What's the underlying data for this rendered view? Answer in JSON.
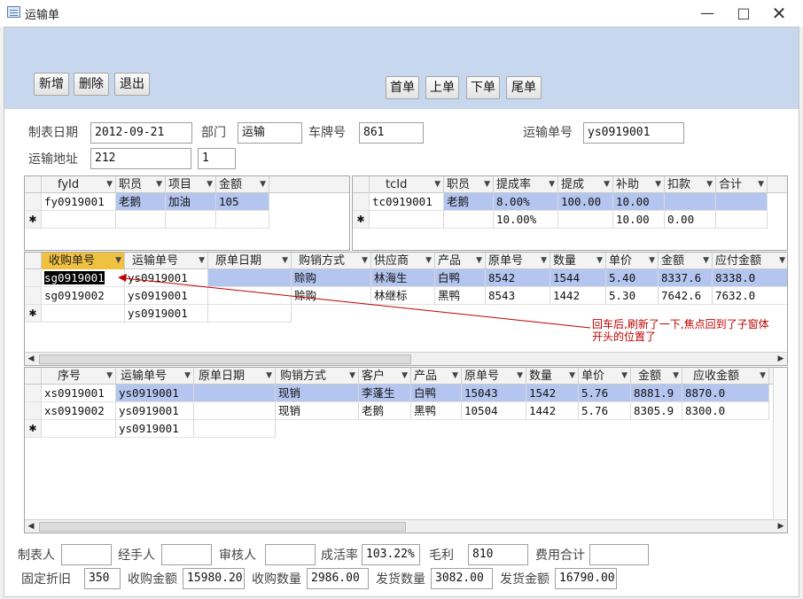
{
  "window": {
    "title": "运输单"
  },
  "toolbar": {
    "new": "新增",
    "delete": "删除",
    "exit": "退出",
    "first": "首单",
    "prev": "上单",
    "next": "下单",
    "last": "尾单"
  },
  "header": {
    "date_label": "制表日期",
    "date_value": "2012-09-21",
    "dept_label": "部门",
    "dept_value": "运输",
    "plate_label": "车牌号",
    "plate_value": "861",
    "order_label": "运输单号",
    "order_value": "ys0919001",
    "addr_label": "运输地址",
    "addr_value": "212",
    "addr_extra": "1"
  },
  "fee_grid": {
    "columns": [
      "fyId",
      "职员",
      "项目",
      "金额"
    ],
    "rows": [
      [
        "fy0919001",
        "老鹅",
        "加油",
        "105"
      ]
    ]
  },
  "commission_grid": {
    "columns": [
      "tcId",
      "职员",
      "提成率",
      "提成",
      "补助",
      "扣款",
      "合计"
    ],
    "rows": [
      [
        "tc0919001",
        "老鹅",
        "8.00%",
        "100.00",
        "10.00",
        "",
        ""
      ],
      [
        "",
        "",
        "10.00%",
        "",
        "10.00",
        "0.00",
        ""
      ]
    ]
  },
  "purchase_grid": {
    "columns": [
      "收购单号",
      "运输单号",
      "原单日期",
      "购销方式",
      "供应商",
      "产品",
      "原单号",
      "数量",
      "单价",
      "金额",
      "应付金额"
    ],
    "rows": [
      [
        "sg0919001",
        "ys0919001",
        "",
        "赊购",
        "林海生",
        "白鸭",
        "8542",
        "1544",
        "5.40",
        "8337.6",
        "8338.0"
      ],
      [
        "sg0919002",
        "ys0919001",
        "",
        "赊购",
        "林继标",
        "黑鸭",
        "8543",
        "1442",
        "5.30",
        "7642.6",
        "7632.0"
      ]
    ],
    "new_row_order": "ys0919001"
  },
  "sales_grid": {
    "columns": [
      "序号",
      "运输单号",
      "原单日期",
      "购销方式",
      "客户",
      "产品",
      "原单号",
      "数量",
      "单价",
      "金额",
      "应收金额"
    ],
    "rows": [
      [
        "xs0919001",
        "ys0919001",
        "",
        "现销",
        "李蓬生",
        "白鸭",
        "15043",
        "1542",
        "5.76",
        "8881.9",
        "8870.0"
      ],
      [
        "xs0919002",
        "ys0919001",
        "",
        "现销",
        "老鹅",
        "黑鸭",
        "10504",
        "1442",
        "5.76",
        "8305.9",
        "8300.0"
      ]
    ],
    "new_row_order": "ys0919001"
  },
  "annotation": {
    "line1": "回车后,刷新了一下,焦点回到了子窗体",
    "line2": "开头的位置了"
  },
  "footer": {
    "maker_label": "制表人",
    "maker_value": "",
    "handler_label": "经手人",
    "handler_value": "",
    "reviewer_label": "审核人",
    "reviewer_value": "",
    "survival_label": "成活率",
    "survival_value": "103.22%",
    "profit_label": "毛利",
    "profit_value": "810",
    "fee_total_label": "费用合计",
    "fee_total_value": "",
    "depreciation_label": "固定折旧",
    "depreciation_value": "350",
    "purchase_amount_label": "收购金额",
    "purchase_amount_value": "15980.20",
    "purchase_qty_label": "收购数量",
    "purchase_qty_value": "2986.00",
    "ship_qty_label": "发货数量",
    "ship_qty_value": "3082.00",
    "ship_amount_label": "发货金额",
    "ship_amount_value": "16790.00"
  },
  "colors": {
    "header_bg": "#c6d7ee",
    "selected_row": "#b4c5f0",
    "selected_header": "#f0c040",
    "annotation": "#c00000"
  }
}
